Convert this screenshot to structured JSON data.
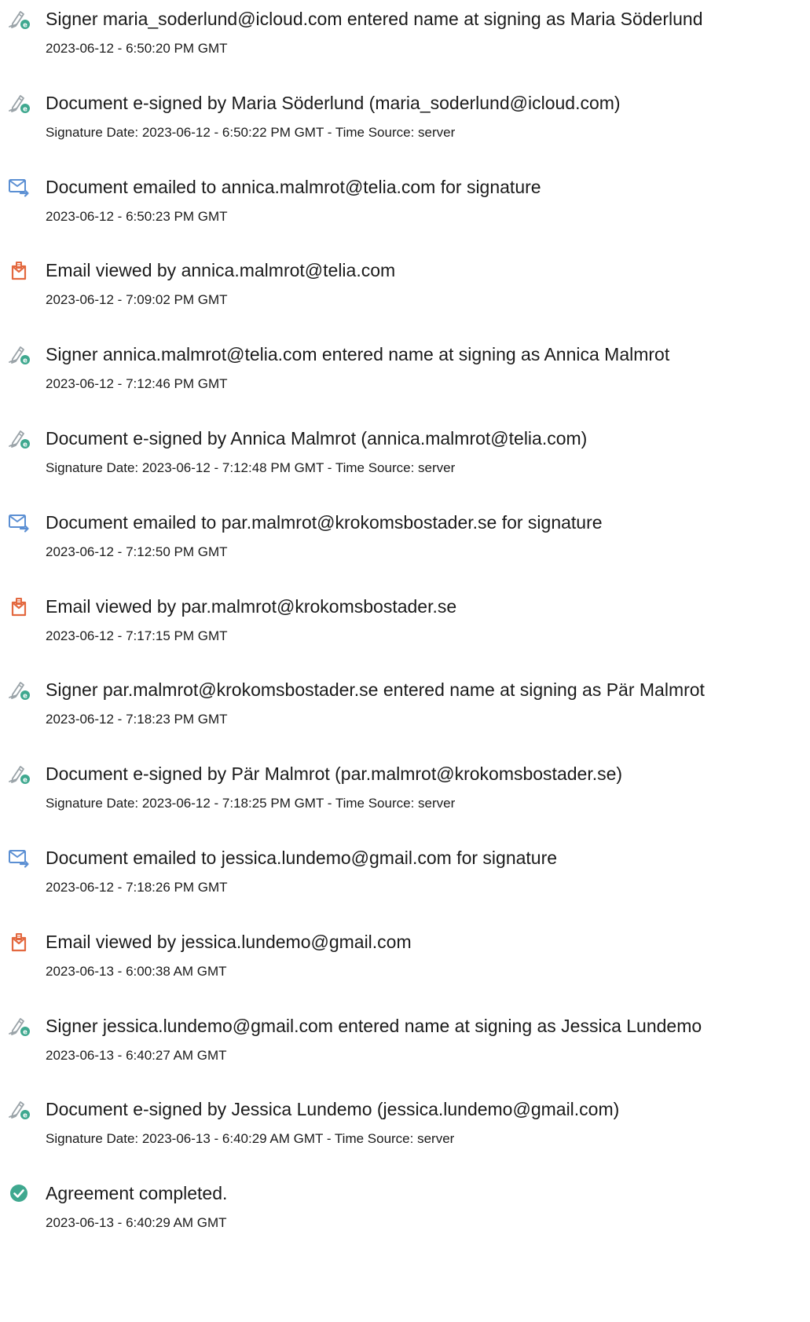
{
  "colors": {
    "sign_icon": "#9aa3a8",
    "sign_badge": "#3fa88f",
    "email_icon": "#5b8fd3",
    "view_icon": "#e3683f",
    "complete_icon": "#3fa88f"
  },
  "events": [
    {
      "icon": "signer-icon",
      "title": "Signer maria_soderlund@icloud.com entered name at signing as Maria Söderlund",
      "sub": "2023-06-12 - 6:50:20 PM GMT"
    },
    {
      "icon": "signer-icon",
      "title": "Document e-signed by Maria Söderlund (maria_soderlund@icloud.com)",
      "sub": "Signature Date: 2023-06-12 - 6:50:22 PM GMT - Time Source: server"
    },
    {
      "icon": "email-sent-icon",
      "title": "Document emailed to annica.malmrot@telia.com for signature",
      "sub": "2023-06-12 - 6:50:23 PM GMT"
    },
    {
      "icon": "email-viewed-icon",
      "title": "Email viewed by annica.malmrot@telia.com",
      "sub": "2023-06-12 - 7:09:02 PM GMT"
    },
    {
      "icon": "signer-icon",
      "title": "Signer annica.malmrot@telia.com entered name at signing as Annica Malmrot",
      "sub": "2023-06-12 - 7:12:46 PM GMT"
    },
    {
      "icon": "signer-icon",
      "title": "Document e-signed by Annica Malmrot (annica.malmrot@telia.com)",
      "sub": "Signature Date: 2023-06-12 - 7:12:48 PM GMT - Time Source: server"
    },
    {
      "icon": "email-sent-icon",
      "title": "Document emailed to par.malmrot@krokomsbostader.se for signature",
      "sub": "2023-06-12 - 7:12:50 PM GMT"
    },
    {
      "icon": "email-viewed-icon",
      "title": "Email viewed by par.malmrot@krokomsbostader.se",
      "sub": "2023-06-12 - 7:17:15 PM GMT"
    },
    {
      "icon": "signer-icon",
      "title": "Signer par.malmrot@krokomsbostader.se entered name at signing as Pär Malmrot",
      "sub": "2023-06-12 - 7:18:23 PM GMT"
    },
    {
      "icon": "signer-icon",
      "title": "Document e-signed by Pär Malmrot (par.malmrot@krokomsbostader.se)",
      "sub": "Signature Date: 2023-06-12 - 7:18:25 PM GMT - Time Source: server"
    },
    {
      "icon": "email-sent-icon",
      "title": "Document emailed to jessica.lundemo@gmail.com for signature",
      "sub": "2023-06-12 - 7:18:26 PM GMT"
    },
    {
      "icon": "email-viewed-icon",
      "title": "Email viewed by jessica.lundemo@gmail.com",
      "sub": "2023-06-13 - 6:00:38 AM GMT"
    },
    {
      "icon": "signer-icon",
      "title": "Signer jessica.lundemo@gmail.com entered name at signing as Jessica Lundemo",
      "sub": "2023-06-13 - 6:40:27 AM GMT"
    },
    {
      "icon": "signer-icon",
      "title": "Document e-signed by Jessica Lundemo (jessica.lundemo@gmail.com)",
      "sub": "Signature Date: 2023-06-13 - 6:40:29 AM GMT - Time Source: server"
    },
    {
      "icon": "completed-icon",
      "title": "Agreement completed.",
      "sub": "2023-06-13 - 6:40:29 AM GMT"
    }
  ]
}
